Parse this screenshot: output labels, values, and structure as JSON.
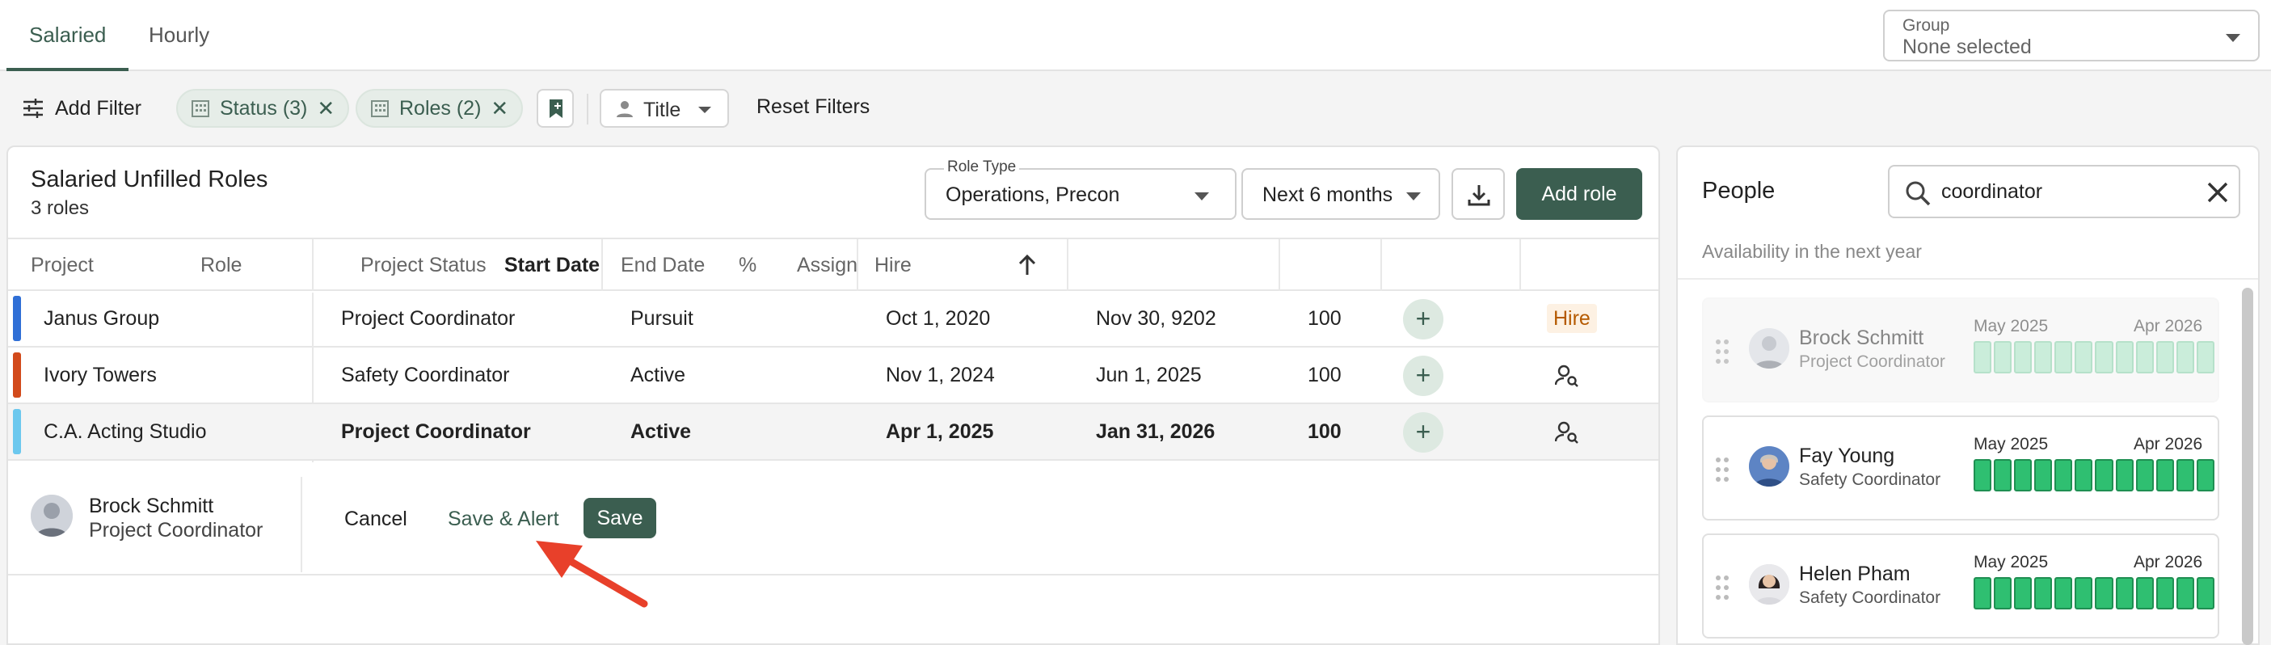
{
  "tabs": [
    {
      "label": "Salaried",
      "active": true
    },
    {
      "label": "Hourly",
      "active": false
    }
  ],
  "group": {
    "label": "Group",
    "value": "None selected"
  },
  "filters": {
    "add_filter": "Add Filter",
    "chips": [
      {
        "label": "Status (3)"
      },
      {
        "label": "Roles (2)"
      }
    ],
    "title_label": "Title",
    "reset": "Reset Filters"
  },
  "main": {
    "title": "Salaried Unfilled Roles",
    "subtitle": "3 roles",
    "role_type_label": "Role Type",
    "role_type_value": "Operations, Precon",
    "period_value": "Next 6 months",
    "add_role": "Add role",
    "columns": [
      "Project",
      "Role",
      "Project Status",
      "Start Date",
      "End Date",
      "%",
      "Assign",
      "Hire"
    ],
    "rows": [
      {
        "project": "Janus Group",
        "role": "Project Coordinator",
        "status": "Pursuit",
        "start": "Oct 1, 2020",
        "end": "Nov 30, 9202",
        "pct": "100",
        "hire": "Hire",
        "color": "#2f6fd6"
      },
      {
        "project": "Ivory Towers",
        "role": "Safety Coordinator",
        "status": "Active",
        "start": "Nov 1, 2024",
        "end": "Jun 1, 2025",
        "pct": "100",
        "hire": "",
        "color": "#d24a1b"
      },
      {
        "project": "C.A. Acting Studio",
        "role": "Project Coordinator",
        "status": "Active",
        "start": "Apr 1, 2025",
        "end": "Jan 31, 2026",
        "pct": "100",
        "hire": "",
        "color": "#6cc8ee"
      }
    ],
    "assign_symbol": "+",
    "assignee": {
      "name": "Brock Schmitt",
      "role": "Project Coordinator"
    },
    "actions": {
      "cancel": "Cancel",
      "save_alert": "Save & Alert",
      "save": "Save"
    }
  },
  "people": {
    "title": "People",
    "search_value": "coordinator",
    "availability_label": "Availability in the next year",
    "list": [
      {
        "name": "Brock Schmitt",
        "role": "Project Coordinator",
        "from": "May 2025",
        "to": "Apr 2026",
        "dimmed": true
      },
      {
        "name": "Fay Young",
        "role": "Safety Coordinator",
        "from": "May 2025",
        "to": "Apr 2026",
        "dimmed": false
      },
      {
        "name": "Helen Pham",
        "role": "Safety Coordinator",
        "from": "May 2025",
        "to": "Apr 2026",
        "dimmed": false
      }
    ]
  },
  "colors": {
    "brand": "#3b5e50",
    "available": "#2fbf71",
    "annotation": "#e8402a"
  },
  "icons": [
    "tune-icon",
    "building-icon",
    "close-icon",
    "bookmark-icon",
    "person-icon",
    "chevron-down-icon",
    "download-icon",
    "sort-arrow-up-icon",
    "plus-icon",
    "person-search-icon",
    "search-icon",
    "drag-handle-icon",
    "avatar-icon"
  ]
}
